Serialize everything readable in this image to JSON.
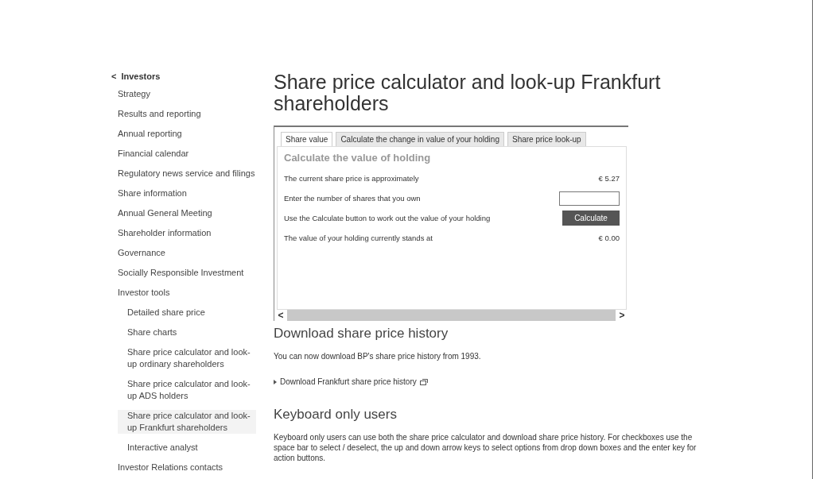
{
  "sidebar": {
    "back": {
      "icon": "<",
      "label": "Investors"
    },
    "items": [
      {
        "label": "Strategy",
        "selected": false
      },
      {
        "label": "Results and reporting",
        "selected": false
      },
      {
        "label": "Annual reporting",
        "selected": false
      },
      {
        "label": "Financial calendar",
        "selected": false
      },
      {
        "label": "Regulatory news service and filings",
        "selected": false
      },
      {
        "label": "Share information",
        "selected": false
      },
      {
        "label": "Annual General Meeting",
        "selected": false
      },
      {
        "label": "Shareholder information",
        "selected": false
      },
      {
        "label": "Governance",
        "selected": false
      },
      {
        "label": "Socially Responsible Investment",
        "selected": false
      },
      {
        "label": "Investor tools",
        "selected": false,
        "children": [
          {
            "label": "Detailed share price",
            "selected": false
          },
          {
            "label": "Share charts",
            "selected": false
          },
          {
            "label": "Share price calculator and look-up ordinary shareholders",
            "selected": false
          },
          {
            "label": "Share price calculator and look-up ADS holders",
            "selected": false
          },
          {
            "label": "Share price calculator and look-up Frankfurt shareholders",
            "selected": true
          },
          {
            "label": "Interactive analyst",
            "selected": false
          }
        ]
      },
      {
        "label": "Investor Relations contacts",
        "selected": false
      }
    ]
  },
  "title": "Share price calculator and look-up Frankfurt shareholders",
  "calculator": {
    "tabs": [
      {
        "label": "Share value",
        "selected": true
      },
      {
        "label": "Calculate the change in value of your holding",
        "selected": false
      },
      {
        "label": "Share price look-up",
        "selected": false
      }
    ],
    "heading": "Calculate the value of holding",
    "rows": [
      {
        "kind": "value",
        "label": "The current share price is approximately",
        "value": "€ 5.27"
      },
      {
        "kind": "input",
        "label": "Enter the number of shares that you own"
      },
      {
        "kind": "button",
        "label": "Use the Calculate button to work out the value of your holding",
        "button": "Calculate"
      },
      {
        "kind": "value",
        "label": "The value of your holding currently stands at",
        "value": "€ 0.00"
      }
    ],
    "scroll_left": "<",
    "scroll_right": ">"
  },
  "download": {
    "heading": "Download share price history",
    "text": "You can now download BP's share price history from 1993.",
    "link": "Download Frankfurt share price history"
  },
  "keyboard": {
    "heading": "Keyboard only users",
    "text": "Keyboard only users can use both the share price calculator and download share price history. For checkboxes use the space bar to select / deselect, the up and down arrow keys to select options from drop down boxes and the enter key for action buttons."
  }
}
